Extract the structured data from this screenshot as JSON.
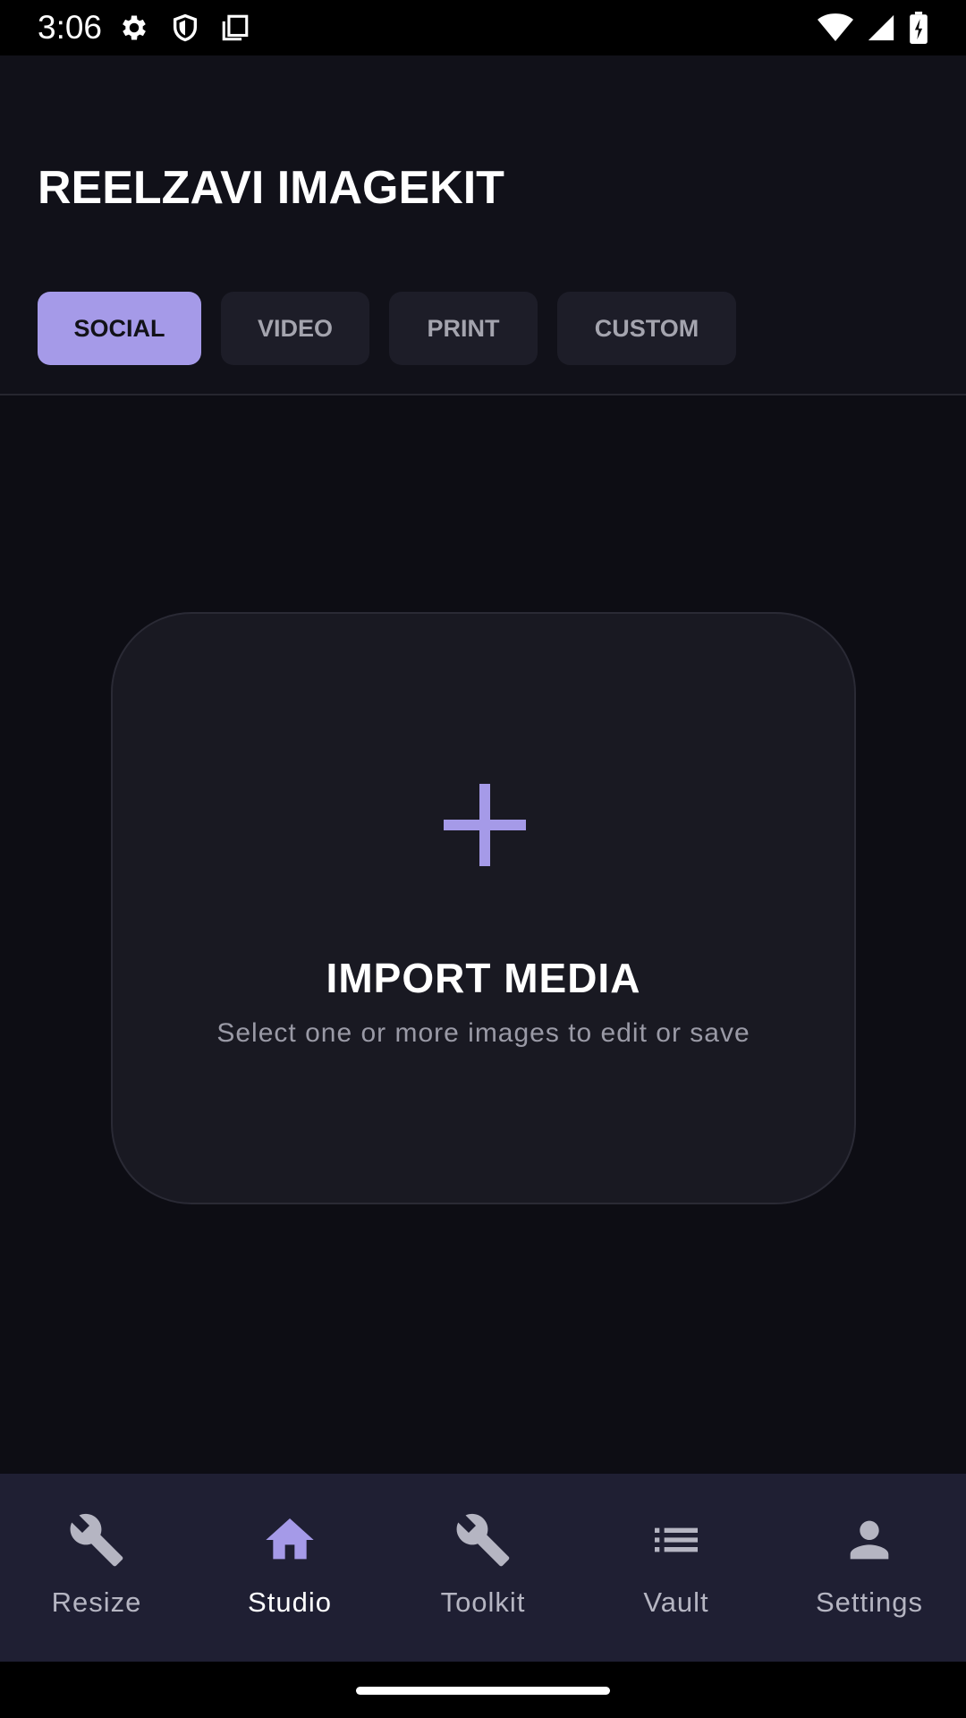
{
  "status_bar": {
    "time": "3:06",
    "left_icons": [
      "gear-icon",
      "shield-icon",
      "screenshot-icon"
    ],
    "right_icons": [
      "wifi-icon",
      "signal-icon",
      "battery-charging-icon"
    ]
  },
  "header": {
    "title": "REELZAVI IMAGEKIT",
    "tabs": [
      {
        "label": "SOCIAL",
        "active": true
      },
      {
        "label": "VIDEO",
        "active": false
      },
      {
        "label": "PRINT",
        "active": false
      },
      {
        "label": "CUSTOM",
        "active": false
      }
    ]
  },
  "main": {
    "import_card": {
      "icon": "plus-icon",
      "title": "IMPORT MEDIA",
      "subtitle": "Select one or more images to edit or save"
    }
  },
  "bottom_nav": {
    "items": [
      {
        "label": "Resize",
        "icon": "wrench-icon",
        "active": false
      },
      {
        "label": "Studio",
        "icon": "home-icon",
        "active": true
      },
      {
        "label": "Toolkit",
        "icon": "wrench-icon",
        "active": false
      },
      {
        "label": "Vault",
        "icon": "list-icon",
        "active": false
      },
      {
        "label": "Settings",
        "icon": "person-icon",
        "active": false
      }
    ]
  },
  "colors": {
    "accent": "#a59ae8",
    "background": "#0d0d14",
    "card": "#191922",
    "nav_background": "#1f1f33"
  }
}
